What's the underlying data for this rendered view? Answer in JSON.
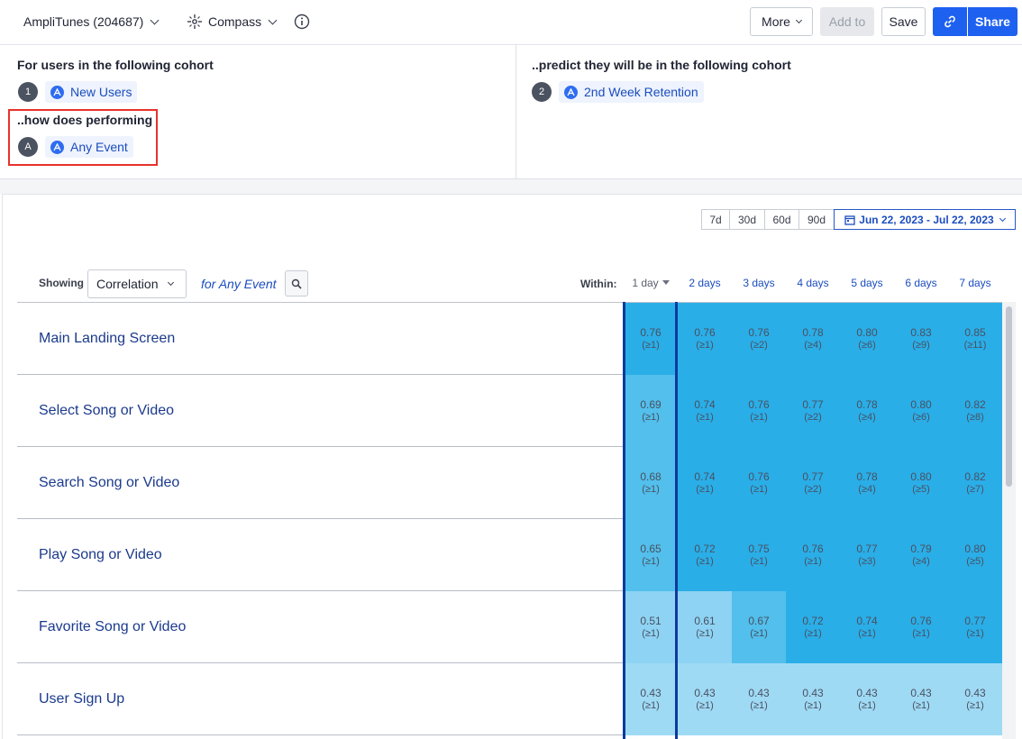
{
  "header": {
    "project_label": "AmpliTunes (204687)",
    "chart_type_label": "Compass",
    "info_icon": "info-circle-icon",
    "more_label": "More",
    "add_to_label": "Add to",
    "save_label": "Save",
    "link_icon": "link-icon",
    "share_label": "Share"
  },
  "cohort_panel": {
    "left_heading": "For users in the following cohort",
    "left_badge": "1",
    "left_chip": "New Users",
    "event_heading": "..how does performing",
    "event_badge": "A",
    "event_chip": "Any Event",
    "right_heading": "..predict they will be in the following cohort",
    "right_badge": "2",
    "right_chip": "2nd Week Retention"
  },
  "date_range": {
    "presets": [
      "7d",
      "30d",
      "60d",
      "90d"
    ],
    "selected_range": "Jun 22, 2023 - Jul 22, 2023"
  },
  "controls": {
    "showing_label": "Showing",
    "metric_value": "Correlation",
    "for_label": "for Any Event",
    "within_label": "Within:",
    "day_headers": [
      "1 day",
      "2 days",
      "3 days",
      "4 days",
      "5 days",
      "6 days",
      "7 days"
    ]
  },
  "table": {
    "rows": [
      {
        "label": "Main Landing Screen",
        "cells": [
          {
            "v": "0.76",
            "n": "(≥1)"
          },
          {
            "v": "0.76",
            "n": "(≥1)"
          },
          {
            "v": "0.76",
            "n": "(≥2)"
          },
          {
            "v": "0.78",
            "n": "(≥4)"
          },
          {
            "v": "0.80",
            "n": "(≥6)"
          },
          {
            "v": "0.83",
            "n": "(≥9)"
          },
          {
            "v": "0.85",
            "n": "(≥11)"
          }
        ]
      },
      {
        "label": "Select Song or Video",
        "cells": [
          {
            "v": "0.69",
            "n": "(≥1)"
          },
          {
            "v": "0.74",
            "n": "(≥1)"
          },
          {
            "v": "0.76",
            "n": "(≥1)"
          },
          {
            "v": "0.77",
            "n": "(≥2)"
          },
          {
            "v": "0.78",
            "n": "(≥4)"
          },
          {
            "v": "0.80",
            "n": "(≥6)"
          },
          {
            "v": "0.82",
            "n": "(≥8)"
          }
        ]
      },
      {
        "label": "Search Song or Video",
        "cells": [
          {
            "v": "0.68",
            "n": "(≥1)"
          },
          {
            "v": "0.74",
            "n": "(≥1)"
          },
          {
            "v": "0.76",
            "n": "(≥1)"
          },
          {
            "v": "0.77",
            "n": "(≥2)"
          },
          {
            "v": "0.78",
            "n": "(≥4)"
          },
          {
            "v": "0.80",
            "n": "(≥5)"
          },
          {
            "v": "0.82",
            "n": "(≥7)"
          }
        ]
      },
      {
        "label": "Play Song or Video",
        "cells": [
          {
            "v": "0.65",
            "n": "(≥1)"
          },
          {
            "v": "0.72",
            "n": "(≥1)"
          },
          {
            "v": "0.75",
            "n": "(≥1)"
          },
          {
            "v": "0.76",
            "n": "(≥1)"
          },
          {
            "v": "0.77",
            "n": "(≥3)"
          },
          {
            "v": "0.79",
            "n": "(≥4)"
          },
          {
            "v": "0.80",
            "n": "(≥5)"
          }
        ]
      },
      {
        "label": "Favorite Song or Video",
        "cells": [
          {
            "v": "0.51",
            "n": "(≥1)"
          },
          {
            "v": "0.61",
            "n": "(≥1)"
          },
          {
            "v": "0.67",
            "n": "(≥1)"
          },
          {
            "v": "0.72",
            "n": "(≥1)"
          },
          {
            "v": "0.74",
            "n": "(≥1)"
          },
          {
            "v": "0.76",
            "n": "(≥1)"
          },
          {
            "v": "0.77",
            "n": "(≥1)"
          }
        ]
      },
      {
        "label": "User Sign Up",
        "cells": [
          {
            "v": "0.43",
            "n": "(≥1)"
          },
          {
            "v": "0.43",
            "n": "(≥1)"
          },
          {
            "v": "0.43",
            "n": "(≥1)"
          },
          {
            "v": "0.43",
            "n": "(≥1)"
          },
          {
            "v": "0.43",
            "n": "(≥1)"
          },
          {
            "v": "0.43",
            "n": "(≥1)"
          },
          {
            "v": "0.43",
            "n": "(≥1)"
          }
        ]
      }
    ]
  },
  "colors": {
    "accent": "#1e61f0",
    "highlight_box": "#e8322b",
    "cell_strong": "#2aaee8",
    "cell_medium": "#52bfec",
    "cell_light": "#8ed3f3",
    "cell_faint": "#9fdaf5"
  }
}
